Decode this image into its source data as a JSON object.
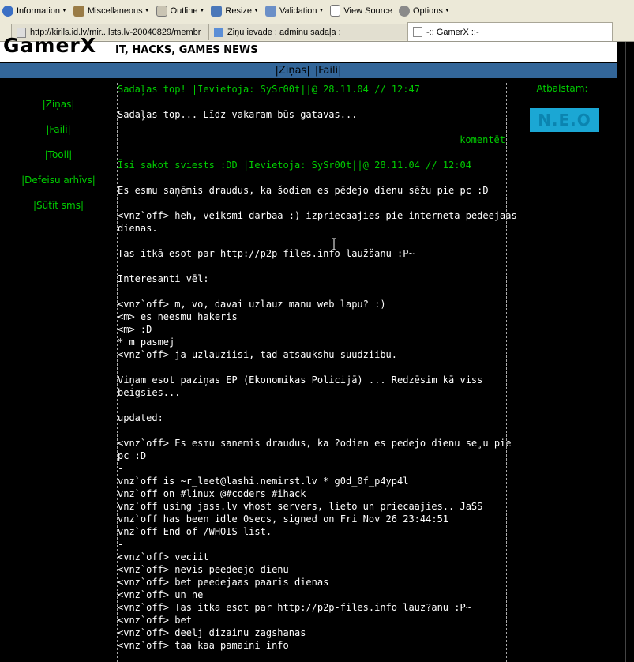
{
  "toolbar": {
    "items": [
      {
        "label": "Information"
      },
      {
        "label": "Miscellaneous"
      },
      {
        "label": "Outline"
      },
      {
        "label": "Resize"
      },
      {
        "label": "Validation"
      },
      {
        "label": "View Source"
      },
      {
        "label": "Options"
      }
    ]
  },
  "tabs": [
    {
      "label": "http://kirils.id.lv/mir...lsts.lv-20040829/membr"
    },
    {
      "label": "Ziņu ievade : adminu sadaļa :"
    },
    {
      "label": "-:: GamerX ::-"
    }
  ],
  "header": {
    "logo": "GamerX",
    "tagline": "IT, HACKS, GAMES NEWS"
  },
  "navbar": {
    "items": [
      "|Ziņas|",
      "|Faili|"
    ]
  },
  "sidebar": {
    "items": [
      "|Ziņas|",
      "|Faili|",
      "|Tooli|",
      "|Defeisu arhīvs|",
      "|Sūtīt sms|"
    ]
  },
  "right": {
    "title": "Atbalstam:",
    "banner": "N.E.O"
  },
  "posts": {
    "post1_header": "Sadaļas top! |Ievietoja: SySr00t||@ 28.11.04 // 12:47",
    "post1_body": "Sadaļas top... Līdz vakaram būs gatavas...",
    "comment_link": "komentēt",
    "post2_header": "Īsi sakot sviests :DD |Ievietoja: SySr00t||@ 28.11.04 // 12:04"
  },
  "body_lines": [
    "Es esmu saņēmis draudus, ka šodien es pēdejo dienu sēžu pie pc :D",
    "<vnz`off> heh, veiksmi darbaa :) izpriecaajies pie interneta pedeejaas",
    "dienas.",
    "Tas itkā esot par ",
    "http://p2p-files.info",
    " laužšanu :P~",
    "Interesanti vēl:",
    "<vnz`off> m, vo, davai uzlauz manu web lapu? :)",
    "<m> es neesmu hakeris",
    "<m> :D",
    "* m pasmej",
    "<vnz`off> ja uzlauziisi, tad atsaukshu suudziibu.",
    "Viņam esot paziņas EP (Ekonomikas Policijā) ... Redzēsim kā viss",
    "beigsies...",
    "updated:",
    "<vnz`off> Es esmu sanemis draudus, ka ?odien es pedejo dienu se¸u pie",
    "pc :D",
    "-",
    "vnz`off is ~r_leet@lashi.nemirst.lv * g0d_0f_p4yp4l",
    "vnz`off on #linux @#coders #ihack",
    "vnz`off using jass.lv vhost servers, lieto un priecaajies.. JaSS",
    "vnz`off has been idle 0secs, signed on Fri Nov 26 23:44:51",
    "vnz`off End of /WHOIS list.",
    "-",
    "<vnz`off> veciit",
    "<vnz`off> nevis peedeejo dienu",
    "<vnz`off> bet peedejaas paaris dienas",
    "<vnz`off> un ne",
    "<vnz`off> Tas itka esot par http://p2p-files.info lauz?anu :P~",
    "<vnz`off> bet",
    "<vnz`off> deelj dizainu zagshanas",
    "<vnz`off> taa kaa pamaini info"
  ]
}
